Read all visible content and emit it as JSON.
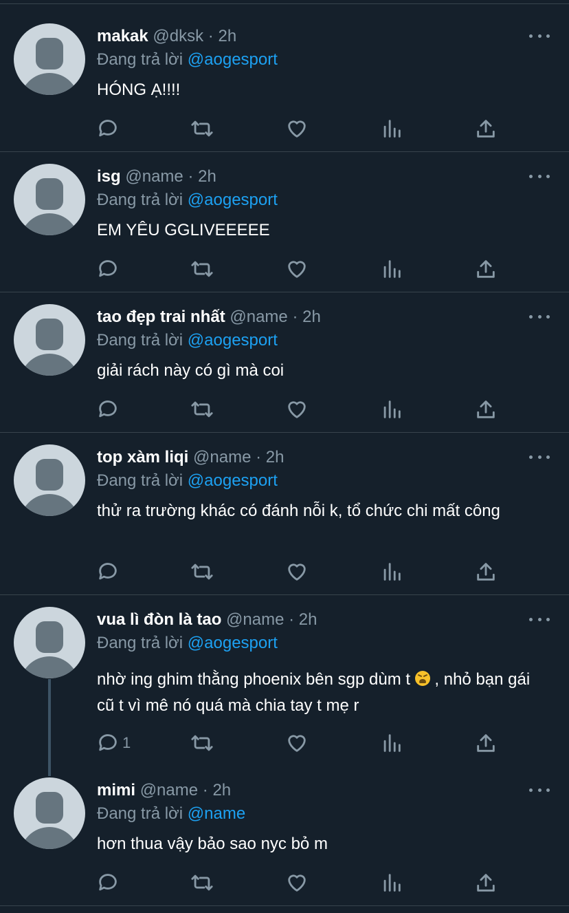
{
  "replying_label": "Đang trả lời",
  "tweets": [
    {
      "display_name": "makak",
      "handle": "@dksk",
      "separator": "·",
      "time": "2h",
      "reply_to": "@aogesport",
      "text": "HÓNG Ạ!!!!",
      "reply_count": ""
    },
    {
      "display_name": "isg",
      "handle": "@name",
      "separator": "·",
      "time": "2h",
      "reply_to": "@aogesport",
      "text": "EM YÊU GGLIVEEEEE",
      "reply_count": ""
    },
    {
      "display_name": "tao đẹp trai nhất",
      "handle": "@name",
      "separator": "·",
      "time": "2h",
      "reply_to": "@aogesport",
      "text": "giải rách này có gì mà coi",
      "reply_count": ""
    },
    {
      "display_name": "top xàm liqi",
      "handle": "@name",
      "separator": "·",
      "time": "2h",
      "reply_to": "@aogesport",
      "text": "thử ra trường khác có đánh nỗi k, tổ chức chi mất công",
      "reply_count": ""
    },
    {
      "display_name": "vua lì đòn là tao",
      "handle": "@name",
      "separator": "·",
      "time": "2h",
      "reply_to": "@aogesport",
      "text_before_emoji": "nhờ ing ghim thằng phoenix bên sgp dùm t",
      "emoji": "weary-face",
      "text_after_emoji": ", nhỏ bạn gái cũ t vì mê nó quá mà chia tay t mẹ r",
      "reply_count": "1"
    },
    {
      "display_name": "mimi",
      "handle": "@name",
      "separator": "·",
      "time": "2h",
      "reply_to": "@name",
      "text": "hơn thua vậy bảo sao nyc bỏ m",
      "reply_count": ""
    }
  ],
  "colors": {
    "background": "#15202b",
    "divider": "#38444d",
    "secondary_text": "#8899a6",
    "mention": "#1da1f2",
    "thread_line": "#3d5466"
  }
}
